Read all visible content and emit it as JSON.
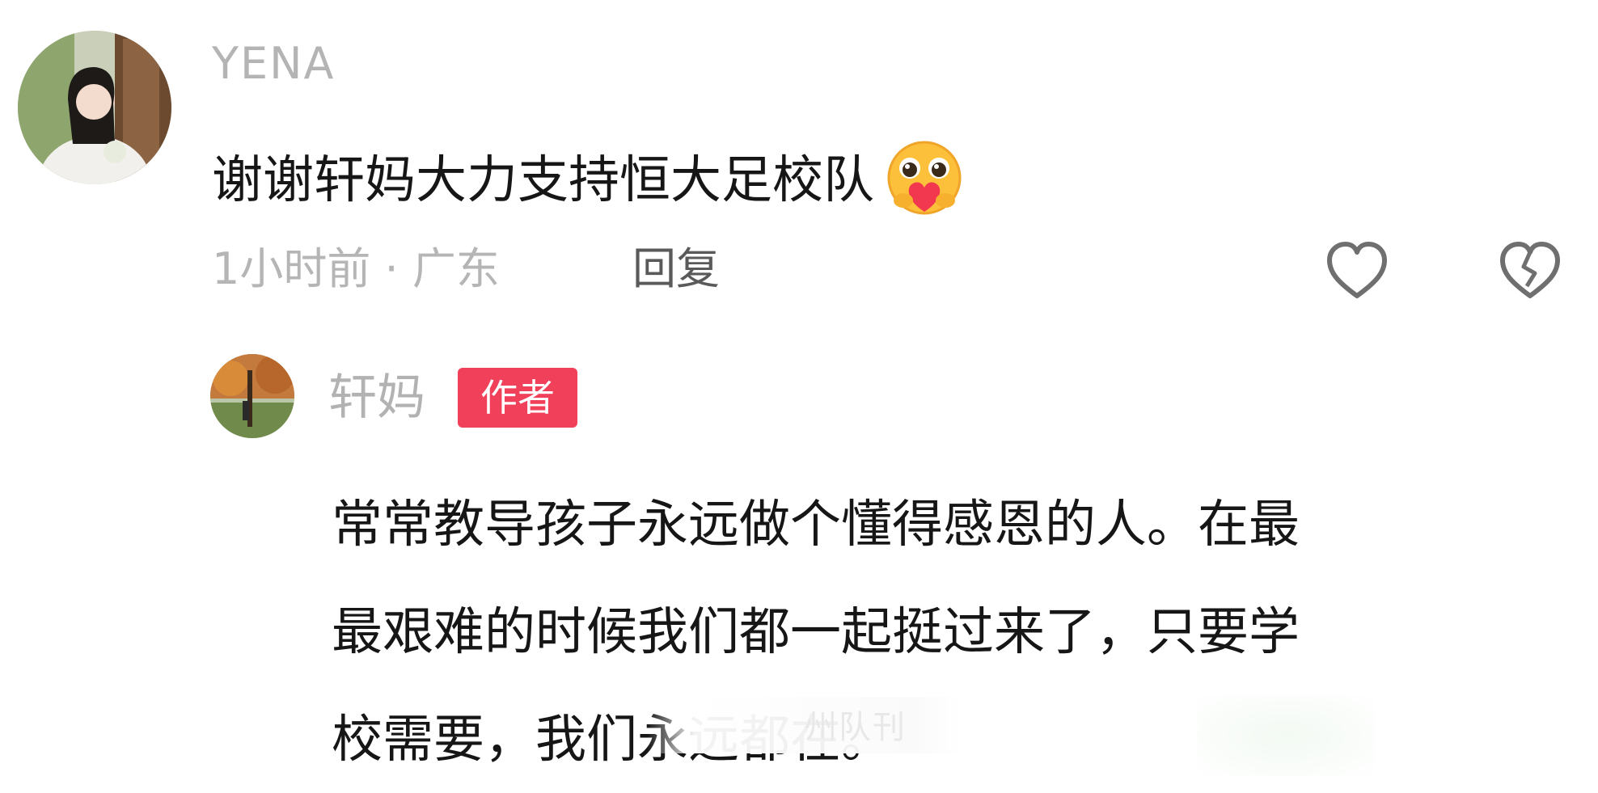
{
  "main_comment": {
    "username": "YENA",
    "text": "谢谢轩妈大力支持恒大足校队",
    "emoji": "hugging-heart-emoji",
    "time_location": "1小时前 · 广东",
    "reply_label": "回复",
    "like_icon": "heart-outline-icon",
    "dislike_icon": "broken-heart-icon"
  },
  "reply_comment": {
    "username": "轩妈",
    "badge": "作者",
    "text": "常常教导孩子永远做个懂得感恩的人。在最\n最艰难的时候我们都一起挺过来了，只要学\n校需要，我们永远都在。"
  },
  "watermark": {
    "text": "州队刊"
  },
  "colors": {
    "badge": "#f0405a",
    "username": "#b4b4b4",
    "text": "#161616",
    "meta": "#b5b5b5"
  }
}
